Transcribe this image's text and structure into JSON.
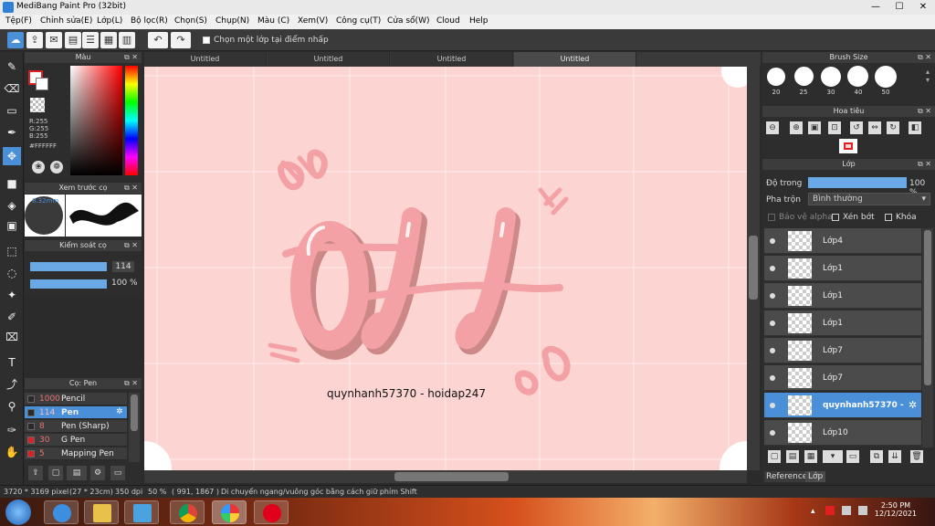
{
  "window": {
    "title": "MediBang Paint Pro (32bit)"
  },
  "menu": [
    "Tệp(F)",
    "Chỉnh sửa(E)",
    "Lớp(L)",
    "Bộ lọc(R)",
    "Chọn(S)",
    "Chụp(N)",
    "Màu (C)",
    "Xem(V)",
    "Công cụ(T)",
    "Cửa sổ(W)",
    "Cloud",
    "Help"
  ],
  "toolbar": {
    "checkbox_label": "Chọn một lớp tại điểm nhấp",
    "undo_icon": "undo-icon",
    "redo_icon": "redo-icon"
  },
  "color_panel": {
    "title": "Màu",
    "r": "R:255",
    "g": "G:255",
    "b": "B:255",
    "hex": "#FFFFFF"
  },
  "brush_preview": {
    "title": "Xem trước cọ",
    "size": "8.32mm"
  },
  "brush_control": {
    "title": "Kiểm soát cọ",
    "size_value": "114",
    "opacity_value": "100 %"
  },
  "brush_list": {
    "title": "Cọ: Pen",
    "items": [
      {
        "size": "1000",
        "name": "Pencil",
        "color": "#2a2a2a"
      },
      {
        "size": "114",
        "name": "Pen",
        "color": "#2a2a2a",
        "selected": true
      },
      {
        "size": "8",
        "name": "Pen (Sharp)",
        "color": "#2a2a2a"
      },
      {
        "size": "30",
        "name": "G Pen",
        "color": "#e02020"
      },
      {
        "size": "5",
        "name": "Mapping Pen",
        "color": "#e02020"
      }
    ]
  },
  "tabs": [
    "Untitled",
    "Untitled",
    "Untitled",
    "Untitled"
  ],
  "canvas": {
    "watermark": "quynhanh57370 - hoidap247",
    "colors": {
      "bg": "#fcd5d3",
      "ink": "#f3a1a4",
      "shadow": "#c47a7a"
    }
  },
  "brush_size_panel": {
    "title": "Brush Size",
    "sizes": [
      "20",
      "25",
      "30",
      "40",
      "50"
    ]
  },
  "navigator": {
    "title": "Hoa tiêu"
  },
  "layers_panel": {
    "title": "Lớp",
    "opacity_label": "Độ trong",
    "opacity_value": "100 %",
    "blend_label": "Pha trộn",
    "blend_value": "Bình thường",
    "protect_alpha": "Bảo vệ alpha",
    "clip": "Xén bớt",
    "lock": "Khóa",
    "layers": [
      {
        "name": "Lớp4"
      },
      {
        "name": "Lớp1"
      },
      {
        "name": "Lớp1"
      },
      {
        "name": "Lớp1"
      },
      {
        "name": "Lớp7"
      },
      {
        "name": "Lớp7"
      },
      {
        "name": "quynhanh57370 -",
        "selected": true
      },
      {
        "name": "Lớp10"
      }
    ],
    "bottom_tabs": [
      "Reference",
      "Lớp"
    ]
  },
  "status": {
    "dims": "3720 * 3169 pixel",
    "physical": "(27 * 23cm)",
    "dpi": "350 dpi",
    "zoom": "50 %",
    "coords": "( 991, 1867 )",
    "hint": "Di chuyển ngang/vuông góc bằng cách giữ phím Shift"
  },
  "taskbar": {
    "time": "2:50 PM",
    "date": "12/12/2021"
  }
}
